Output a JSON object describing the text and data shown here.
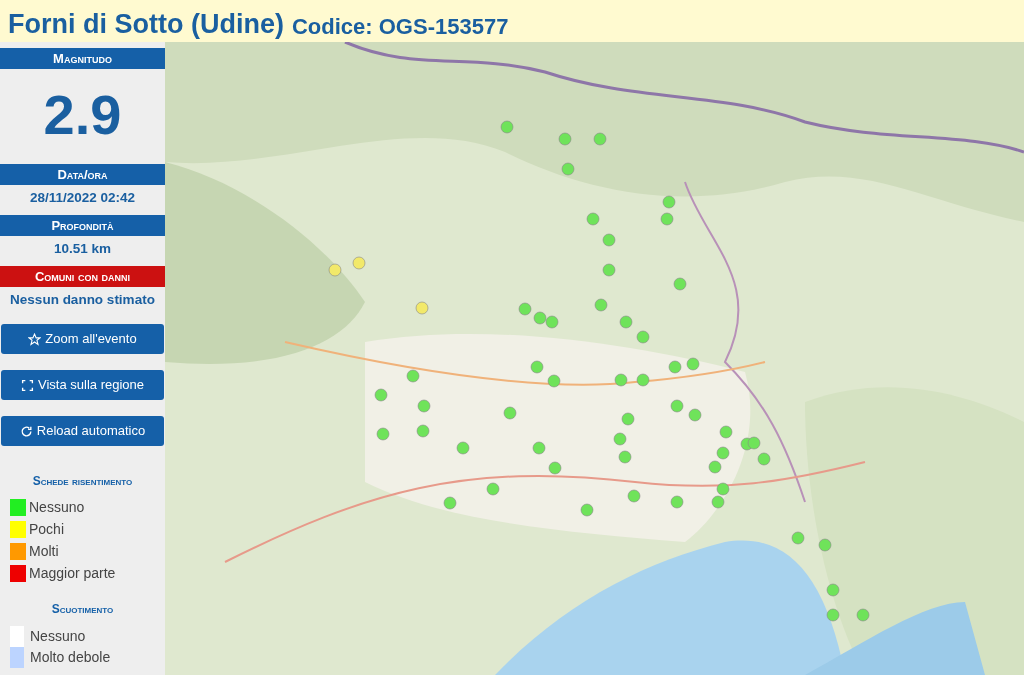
{
  "header": {
    "place": "Forni di Sotto (Udine)",
    "code": "Codice: OGS-153577"
  },
  "sections": [
    {
      "kind": "magnitude",
      "title": "Magnitudo",
      "value": "2.9",
      "alert": false
    },
    {
      "kind": "info",
      "title": "Data/ora",
      "value": "28/11/2022 02:42",
      "alert": false
    },
    {
      "kind": "info",
      "title": "Profondità",
      "value": "10.51 km",
      "alert": false
    },
    {
      "kind": "info",
      "title": "Comuni con danni",
      "value": "Nessun danno stimato",
      "alert": true
    }
  ],
  "buttons": [
    {
      "kind": "star",
      "label": "Zoom all'evento"
    },
    {
      "kind": "expand",
      "label": "Vista sulla regione"
    },
    {
      "kind": "reload",
      "label": "Reload automatico"
    }
  ],
  "legend_reports": {
    "title": "Schede risentimento",
    "items": [
      {
        "label": "Nessuno",
        "color": "#22ee22"
      },
      {
        "label": "Pochi",
        "color": "#ffff00"
      },
      {
        "label": "Molti",
        "color": "#ff9900"
      },
      {
        "label": "Maggior parte",
        "color": "#ee0000"
      }
    ]
  },
  "legend_shaking": {
    "title": "Scuotimento",
    "items": [
      {
        "label": "Nessuno",
        "color": "#ffffff"
      },
      {
        "label": "Molto debole",
        "color": "#bcd4ff"
      }
    ]
  }
}
